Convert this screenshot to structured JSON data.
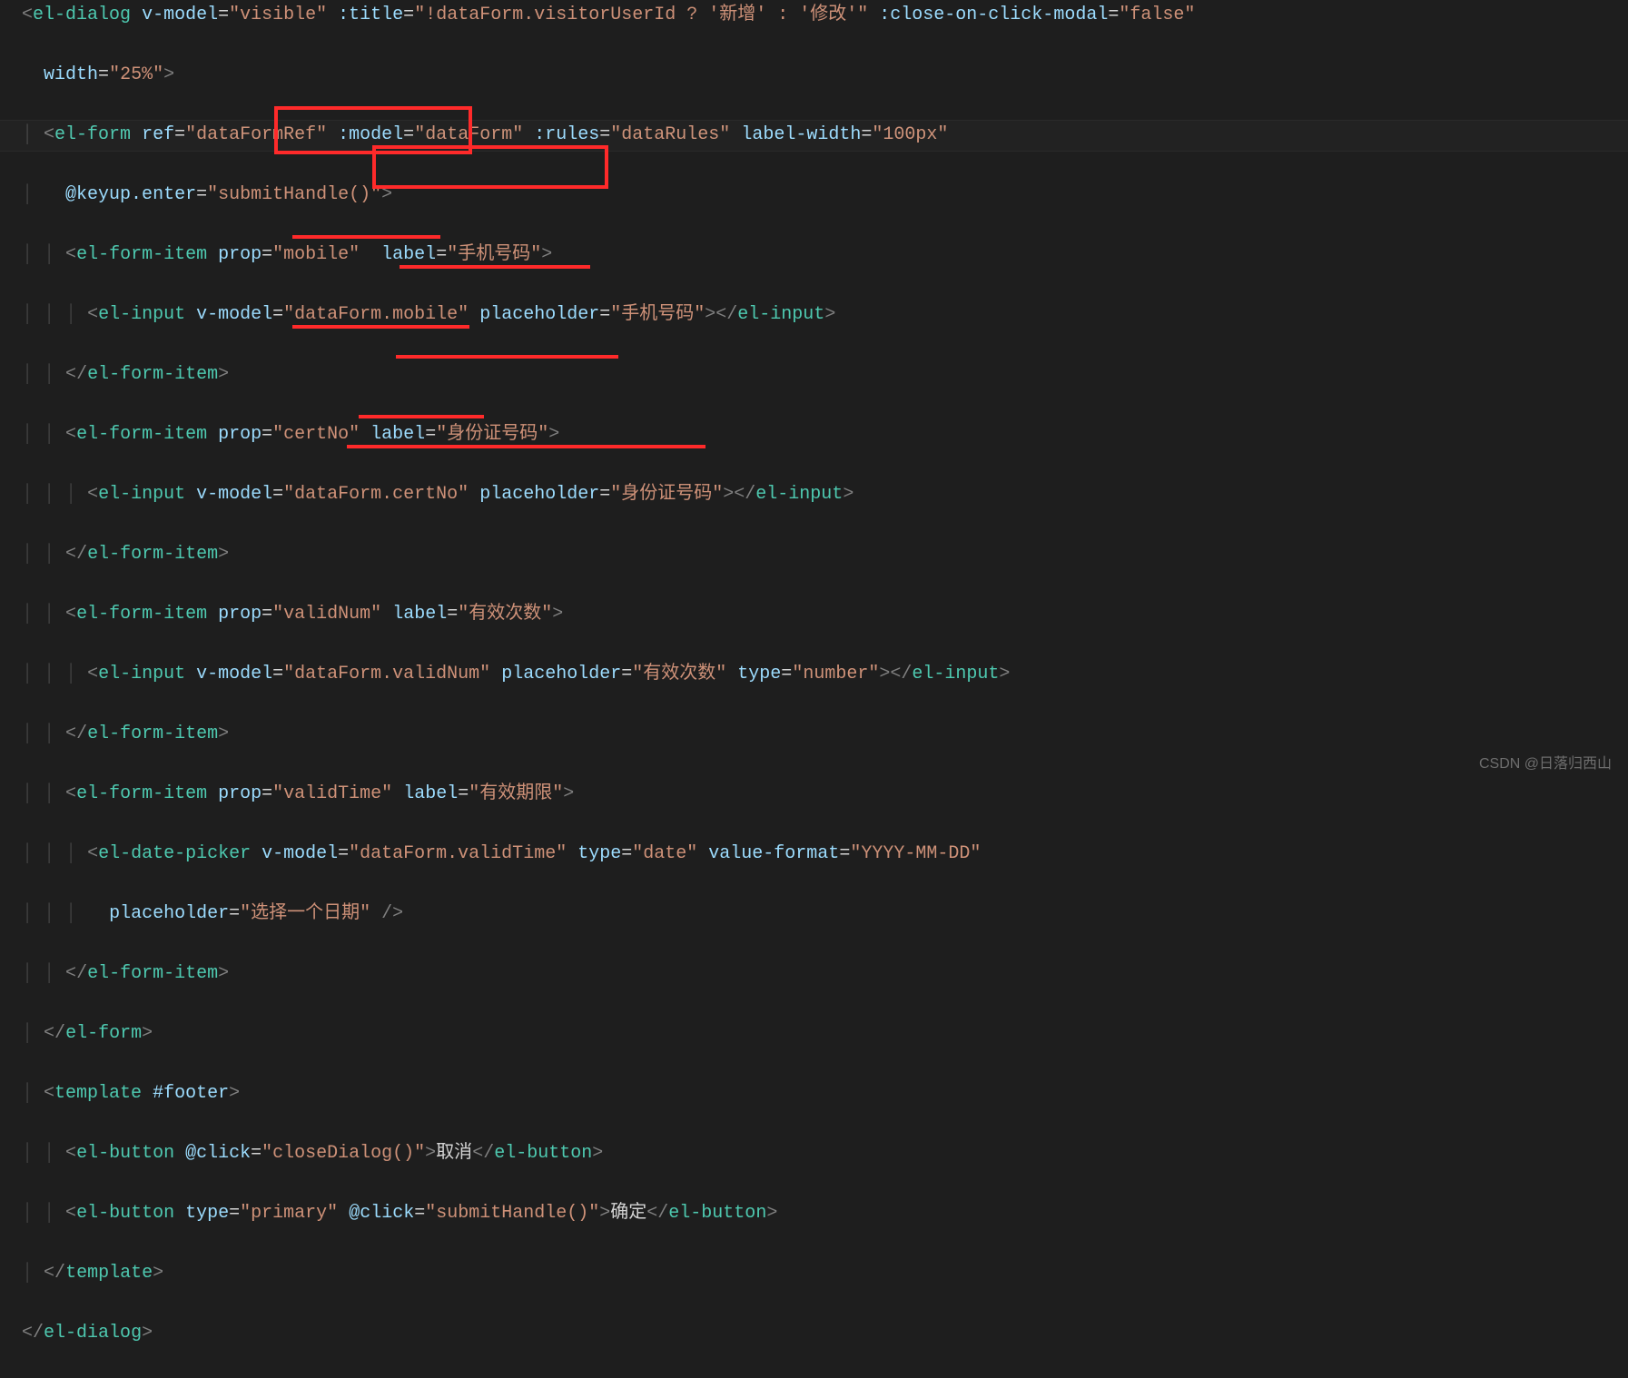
{
  "code": {
    "l1": "  <el-dialog v-model=\"visible\" :title=\"!dataForm.visitorUserId ? '新增' : '修改'\" :close-on-click-modal=\"false\"",
    "l2": "    width=\"25%\">",
    "l3": "    <el-form ref=\"dataFormRef\" :model=\"dataForm\" :rules=\"dataRules\" label-width=\"100px\"",
    "l4": "      @keyup.enter=\"submitHandle()\">",
    "l5": "      <el-form-item prop=\"mobile\"  label=\"手机号码\">",
    "l6": "        <el-input v-model=\"dataForm.mobile\" placeholder=\"手机号码\"></el-input>",
    "l7": "      </el-form-item>",
    "l8": "      <el-form-item prop=\"certNo\" label=\"身份证号码\">",
    "l9": "        <el-input v-model=\"dataForm.certNo\" placeholder=\"身份证号码\"></el-input>",
    "l10": "      </el-form-item>",
    "l11": "      <el-form-item prop=\"validNum\" label=\"有效次数\">",
    "l12": "        <el-input v-model=\"dataForm.validNum\" placeholder=\"有效次数\" type=\"number\"></el-input>",
    "l13": "      </el-form-item>",
    "l14": "      <el-form-item prop=\"validTime\" label=\"有效期限\">",
    "l15": "        <el-date-picker v-model=\"dataForm.validTime\" type=\"date\" value-format=\"YYYY-MM-DD\"",
    "l16": "          placeholder=\"选择一个日期\" />",
    "l17": "      </el-form-item>",
    "l18": "    </el-form>",
    "l19": "    <template #footer>",
    "l20": "      <el-button @click=\"closeDialog()\">取消</el-button>",
    "l21": "      <el-button type=\"primary\" @click=\"submitHandle()\">确定</el-button>",
    "l22": "    </template>",
    "l23": "  </el-dialog>"
  },
  "watermark": "CSDN @日落归西山"
}
